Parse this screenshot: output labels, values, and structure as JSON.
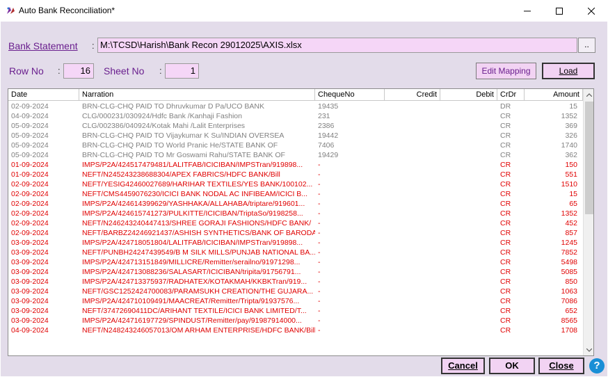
{
  "window": {
    "title": "Auto Bank Reconciliation*",
    "minimize_icon": "minimize-icon",
    "maximize_icon": "maximize-icon",
    "close_icon": "close-icon"
  },
  "form": {
    "bank_statement_label": "Bank Statement",
    "colon": ":",
    "bank_statement_path": "M:\\TCSD\\Harish\\Bank Recon 29012025\\AXIS.xlsx",
    "browse_label": "..",
    "row_no_label": "Row No",
    "row_no_value": "16",
    "sheet_no_label": "Sheet No",
    "sheet_no_value": "1",
    "edit_mapping_label": "Edit Mapping",
    "load_label": "Load"
  },
  "grid": {
    "columns": [
      "Date",
      "Narration",
      "ChequeNo",
      "Credit",
      "Debit",
      "CrDr",
      "Amount"
    ],
    "rows": [
      {
        "date": "02-09-2024",
        "narration": "BRN-CLG-CHQ PAID TO Dhruvkumar D Pa/UCO BANK",
        "cheque": "19435",
        "credit": "",
        "debit": "",
        "crdr": "DR",
        "amount": "15",
        "style": "gray"
      },
      {
        "date": "04-09-2024",
        "narration": "CLG/000231/030924/Hdfc Bank  /Kanhaji Fashion",
        "cheque": "231",
        "credit": "",
        "debit": "",
        "crdr": "CR",
        "amount": "1352",
        "style": "gray"
      },
      {
        "date": "05-09-2024",
        "narration": "CLG/002386/040924/Kotak Mahi /Lalit Enterprises",
        "cheque": "2386",
        "credit": "",
        "debit": "",
        "crdr": "CR",
        "amount": "369",
        "style": "gray"
      },
      {
        "date": "05-09-2024",
        "narration": "BRN-CLG-CHQ PAID TO Vijaykumar K Su/INDIAN OVERSEA",
        "cheque": "19442",
        "credit": "",
        "debit": "",
        "crdr": "CR",
        "amount": "326",
        "style": "gray"
      },
      {
        "date": "05-09-2024",
        "narration": "BRN-CLG-CHQ PAID TO World Pranic He/STATE BANK OF",
        "cheque": "7406",
        "credit": "",
        "debit": "",
        "crdr": "CR",
        "amount": "1740",
        "style": "gray"
      },
      {
        "date": "05-09-2024",
        "narration": "BRN-CLG-CHQ PAID TO Mr Goswami Rahu/STATE BANK OF",
        "cheque": "19429",
        "credit": "",
        "debit": "",
        "crdr": "CR",
        "amount": "362",
        "style": "gray"
      },
      {
        "date": "01-09-2024",
        "narration": "IMPS/P2A/424517479481/LALITFAB/ICICIBAN/IMPSTran/919898...",
        "cheque": "-",
        "credit": "",
        "debit": "",
        "crdr": "CR",
        "amount": "150",
        "style": "red"
      },
      {
        "date": "01-09-2024",
        "narration": "NEFT/N245243238688304/APEX FABRICS/HDFC BANK/Bill",
        "cheque": "-",
        "credit": "",
        "debit": "",
        "crdr": "CR",
        "amount": "551",
        "style": "red"
      },
      {
        "date": "02-09-2024",
        "narration": "NEFT/YESIG42460027689/HARIHAR TEXTILES/YES BANK/100102...",
        "cheque": "-",
        "credit": "",
        "debit": "",
        "crdr": "CR",
        "amount": "1510",
        "style": "red"
      },
      {
        "date": "02-09-2024",
        "narration": "NEFT/CMS4459076230/ICICI BANK NODAL AC INFIBEAM/ICICI B...",
        "cheque": "-",
        "credit": "",
        "debit": "",
        "crdr": "CR",
        "amount": "15",
        "style": "red"
      },
      {
        "date": "02-09-2024",
        "narration": "IMPS/P2A/424614399629/YASHHAKA/ALLAHABA/triptare/919601...",
        "cheque": "-",
        "credit": "",
        "debit": "",
        "crdr": "CR",
        "amount": "65",
        "style": "red"
      },
      {
        "date": "02-09-2024",
        "narration": "IMPS/P2A/424615741273/PULKITTE/ICICIBAN/TriptaSo/9198258...",
        "cheque": "-",
        "credit": "",
        "debit": "",
        "crdr": "CR",
        "amount": "1352",
        "style": "red"
      },
      {
        "date": "02-09-2024",
        "narration": "NEFT/N246243240447413/SHREE GORAJI FASHIONS/HDFC BANK/",
        "cheque": "-",
        "credit": "",
        "debit": "",
        "crdr": "CR",
        "amount": "452",
        "style": "red"
      },
      {
        "date": "02-09-2024",
        "narration": "NEFT/BARBZ24246921437/ASHISH SYNTHETICS/BANK OF BARODA/",
        "cheque": "-",
        "credit": "",
        "debit": "",
        "crdr": "CR",
        "amount": "857",
        "style": "red"
      },
      {
        "date": "03-09-2024",
        "narration": "IMPS/P2A/424718051804/LALITFAB/ICICIBAN/IMPSTran/919898...",
        "cheque": "-",
        "credit": "",
        "debit": "",
        "crdr": "CR",
        "amount": "1245",
        "style": "red"
      },
      {
        "date": "03-09-2024",
        "narration": "NEFT/PUNBH24247439549/B M SILK MILLS/PUNJAB NATIONAL BA...",
        "cheque": "-",
        "credit": "",
        "debit": "",
        "crdr": "CR",
        "amount": "7852",
        "style": "red"
      },
      {
        "date": "03-09-2024",
        "narration": "IMPS/P2A/424713151849/MILLICRE/Remitter/serailno/91971298...",
        "cheque": "-",
        "credit": "",
        "debit": "",
        "crdr": "CR",
        "amount": "5498",
        "style": "red"
      },
      {
        "date": "03-09-2024",
        "narration": "IMPS/P2A/424713088236/SALASART/ICICIBAN/tripita/91756791...",
        "cheque": "-",
        "credit": "",
        "debit": "",
        "crdr": "CR",
        "amount": "5085",
        "style": "red"
      },
      {
        "date": "03-09-2024",
        "narration": "IMPS/P2A/424713375937/RADHATEX/KOTAKMAH/KKBKTran/919...",
        "cheque": "-",
        "credit": "",
        "debit": "",
        "crdr": "CR",
        "amount": "850",
        "style": "red"
      },
      {
        "date": "03-09-2024",
        "narration": "NEFT/GSC1252424700083/PARAMSUKH CREATION/THE GUJARA...",
        "cheque": "-",
        "credit": "",
        "debit": "",
        "crdr": "CR",
        "amount": "1063",
        "style": "red"
      },
      {
        "date": "03-09-2024",
        "narration": "IMPS/P2A/424710109491/MAACREAT/Remitter/Tripta/91937576...",
        "cheque": "-",
        "credit": "",
        "debit": "",
        "crdr": "CR",
        "amount": "7086",
        "style": "red"
      },
      {
        "date": "03-09-2024",
        "narration": "NEFT/37472690411DC/ARIHANT TEXTILE/ICICI BANK LIMITED/T...",
        "cheque": "-",
        "credit": "",
        "debit": "",
        "crdr": "CR",
        "amount": "652",
        "style": "red"
      },
      {
        "date": "03-09-2024",
        "narration": "IMPS/P2A/424716197729/SPINDUST/Remitter/pay/91987914000...",
        "cheque": "-",
        "credit": "",
        "debit": "",
        "crdr": "CR",
        "amount": "8565",
        "style": "red"
      },
      {
        "date": "04-09-2024",
        "narration": "NEFT/N248243246057013/OM ARHAM ENTERPRISE/HDFC BANK/Bill",
        "cheque": "-",
        "credit": "",
        "debit": "",
        "crdr": "CR",
        "amount": "1708",
        "style": "red"
      }
    ]
  },
  "footer": {
    "cancel_label": "Cancel",
    "ok_label": "OK",
    "close_label": "Close",
    "help_label": "?"
  },
  "colors": {
    "background": "#e3dcea",
    "input_fill": "#f5d6f7",
    "label": "#6a1f8e",
    "unmatched_row": "#e00000",
    "matched_row": "#808080",
    "help": "#1a8fd6"
  }
}
